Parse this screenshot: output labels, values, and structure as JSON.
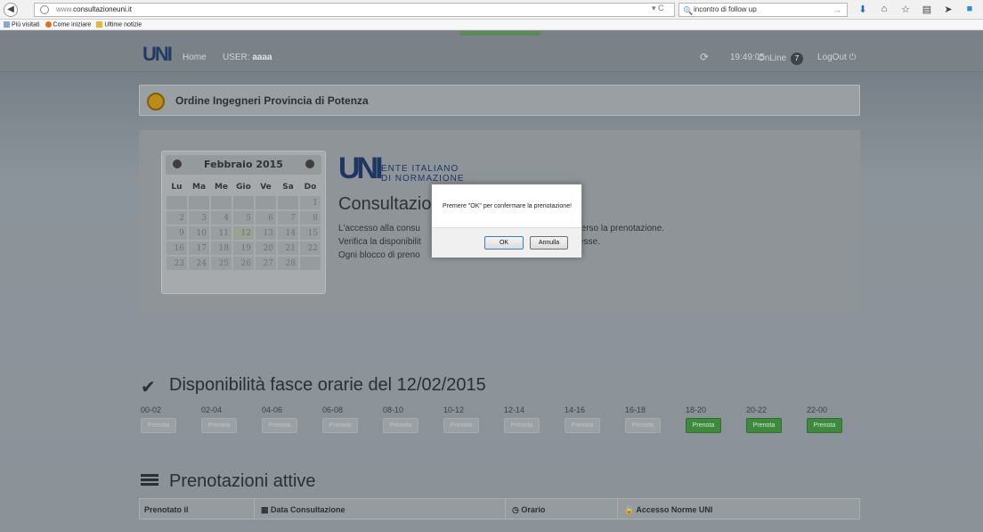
{
  "browser": {
    "url_gray": "www.",
    "url_main": "consultazioneuni.it",
    "search_value": "incontro di follow up",
    "bookmarks": [
      "Più visitati",
      "Come iniziare",
      "Ultime notizie"
    ]
  },
  "nav": {
    "logo": "UNI",
    "home": "Home",
    "user_label": "USER:",
    "user_value": "aaaa",
    "time": "19:49:05",
    "online_label": "OnLine",
    "online_count": "7",
    "logout": "LogOut"
  },
  "org": {
    "title": "Ordine Ingegneri Provincia di Potenza"
  },
  "calendar": {
    "month": "Febbraio 2015",
    "weekdays": [
      "Lu",
      "Ma",
      "Me",
      "Gio",
      "Ve",
      "Sa",
      "Do"
    ],
    "rows": [
      [
        "",
        "",
        "",
        "",
        "",
        "",
        "1"
      ],
      [
        "2",
        "3",
        "4",
        "5",
        "6",
        "7",
        "8"
      ],
      [
        "9",
        "10",
        "11",
        "12",
        "13",
        "14",
        "15"
      ],
      [
        "16",
        "17",
        "18",
        "19",
        "20",
        "21",
        "22"
      ],
      [
        "23",
        "24",
        "25",
        "26",
        "27",
        "28",
        ""
      ]
    ],
    "selected": "12"
  },
  "uni": {
    "line1": "ENTE ITALIANO",
    "line2": "DI NORMAZIONE",
    "title": "Consultazio",
    "l1": "L'accesso alla consu",
    "l1b": "traverso la prenotazione.",
    "l2": "Verifica la disponibilit",
    "l2b": "nteresse.",
    "l3": "Ogni blocco di preno"
  },
  "dialog": {
    "message": "Premere \"OK\" per confermare la prenotazione!",
    "ok": "OK",
    "cancel": "Annulla"
  },
  "disponibilita": {
    "title": "Disponibilità fasce orarie del 12/02/2015",
    "button_label": "Prenota",
    "slots": [
      {
        "label": "00-02",
        "available": false
      },
      {
        "label": "02-04",
        "available": false
      },
      {
        "label": "04-06",
        "available": false
      },
      {
        "label": "06-08",
        "available": false
      },
      {
        "label": "08-10",
        "available": false
      },
      {
        "label": "10-12",
        "available": false
      },
      {
        "label": "12-14",
        "available": false
      },
      {
        "label": "14-16",
        "available": false
      },
      {
        "label": "16-18",
        "available": false
      },
      {
        "label": "18-20",
        "available": true
      },
      {
        "label": "20-22",
        "available": true
      },
      {
        "label": "22-00",
        "available": true
      }
    ]
  },
  "prenotazioni": {
    "title": "Prenotazioni attive",
    "columns": [
      "Prenotato il",
      "Data Consultazione",
      "Orario",
      "Accesso Norme UNI"
    ]
  },
  "colors": {
    "available": "#3d8a3f",
    "logo_blue": "#1d3760"
  }
}
